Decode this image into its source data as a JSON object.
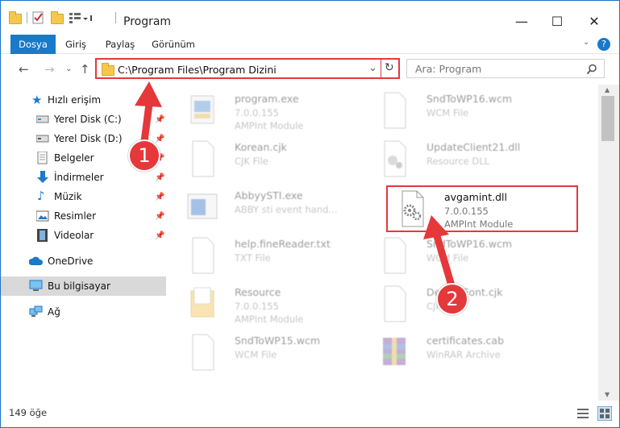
{
  "window": {
    "title": "Program",
    "controls": {
      "minimize": "—",
      "maximize": "☐",
      "close": "✕"
    }
  },
  "ribbon": {
    "tabs": [
      "Dosya",
      "Giriş",
      "Paylaş",
      "Görünüm"
    ],
    "help_icon": "?"
  },
  "address": {
    "path": "C:\\Program Files\\Program Dizini",
    "search_placeholder": "Ara: Program"
  },
  "nav": {
    "items": [
      {
        "label": "Hızlı erişim",
        "icon": "star-icon",
        "pinned": false
      },
      {
        "label": "Yerel Disk (C:)",
        "icon": "drive-icon",
        "pinned": true
      },
      {
        "label": "Yerel Disk (D:)",
        "icon": "drive-icon",
        "pinned": true
      },
      {
        "label": "Belgeler",
        "icon": "documents-icon",
        "pinned": true
      },
      {
        "label": "İndirmeler",
        "icon": "download-icon",
        "pinned": true
      },
      {
        "label": "Müzik",
        "icon": "music-icon",
        "pinned": true
      },
      {
        "label": "Resimler",
        "icon": "pictures-icon",
        "pinned": true
      },
      {
        "label": "Videolar",
        "icon": "video-icon",
        "pinned": true
      },
      {
        "label": "OneDrive",
        "icon": "cloud-icon",
        "pinned": false
      },
      {
        "label": "Bu bilgisayar",
        "icon": "computer-icon",
        "pinned": false,
        "selected": true
      },
      {
        "label": "Ağ",
        "icon": "network-icon",
        "pinned": false
      }
    ]
  },
  "files": [
    {
      "name": "program.exe",
      "line2": "7.0.0.155",
      "line3": "AMPInt Module",
      "icon": "exe-icon",
      "faded": true
    },
    {
      "name": "SndToWP16.wcm",
      "line2": "WCM File",
      "line3": "",
      "icon": "file-icon",
      "faded": true
    },
    {
      "name": "Korean.cjk",
      "line2": "CJK File",
      "line3": "",
      "icon": "file-icon",
      "faded": true
    },
    {
      "name": "UpdateClient21.dll",
      "line2": "Resource DLL",
      "line3": "",
      "icon": "dll-icon",
      "faded": true
    },
    {
      "name": "AbbyySTI.exe",
      "line2": "ABBY sti event hand...",
      "line3": "",
      "icon": "app-icon",
      "faded": true
    },
    {
      "name": "avgamint.dll",
      "line2": "7.0.0.155",
      "line3": "AMPInt Module",
      "icon": "dll-icon",
      "faded": false
    },
    {
      "name": "help.fineReader.txt",
      "line2": "TXT File",
      "line3": "",
      "icon": "file-icon",
      "faded": true
    },
    {
      "name": "SndToWP16.wcm",
      "line2": "WCM File",
      "line3": "",
      "icon": "file-icon",
      "faded": true
    },
    {
      "name": "Resource",
      "line2": "7.0.0.155",
      "line3": "AMPInt Module",
      "icon": "folder-file-icon",
      "faded": true
    },
    {
      "name": "DefaultFont.cjk",
      "line2": "CJK File",
      "line3": "",
      "icon": "file-icon",
      "faded": true
    },
    {
      "name": "SndToWP15.wcm",
      "line2": "WCM File",
      "line3": "",
      "icon": "file-icon",
      "faded": true
    },
    {
      "name": "certificates.cab",
      "line2": "WinRAR Archive",
      "line3": "",
      "icon": "archive-icon",
      "faded": true
    }
  ],
  "status": {
    "count": "149 öğe"
  },
  "annotations": [
    "1",
    "2"
  ],
  "colors": {
    "accent": "#1979ca",
    "highlight": "#e5383b",
    "selected_nav": "#d9d9d9"
  }
}
